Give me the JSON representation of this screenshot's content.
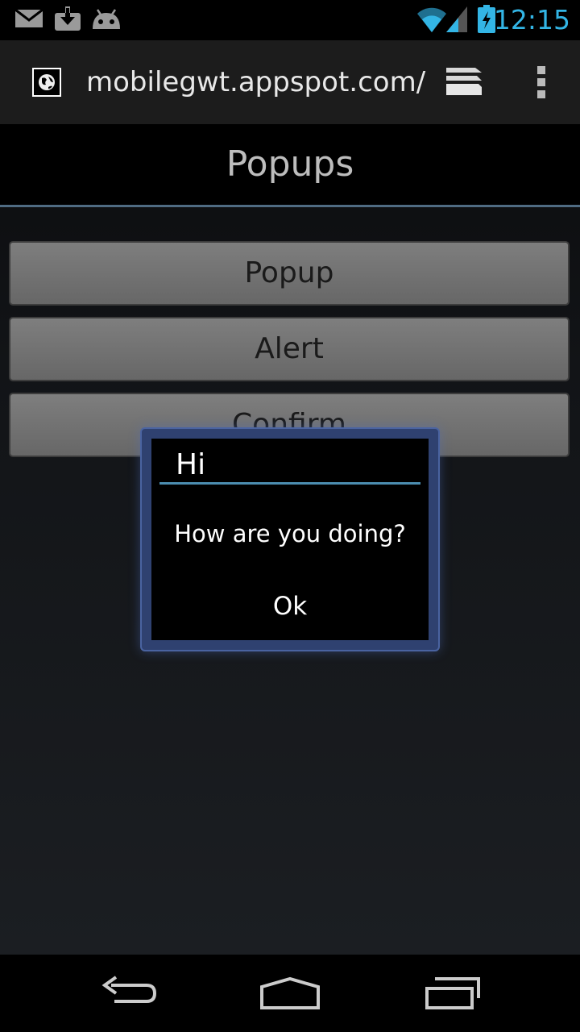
{
  "status_bar": {
    "time": "12:15",
    "icons": [
      "gmail-icon",
      "download-icon",
      "android-icon",
      "wifi-icon",
      "signal-icon",
      "battery-charging-icon"
    ],
    "accent_color": "#33b5e5"
  },
  "toolbar": {
    "url": "mobilegwt.appspot.com/",
    "favicon": "globe-icon",
    "tabs_icon": "tabs-icon",
    "menu_icon": "overflow-menu-icon"
  },
  "page": {
    "title": "Popups",
    "buttons": [
      {
        "label": "Popup"
      },
      {
        "label": "Alert"
      },
      {
        "label": "Confirm"
      }
    ]
  },
  "dialog": {
    "title": "Hi",
    "message": "How are you doing?",
    "ok_label": "Ok",
    "divider_color": "#4c8db0"
  },
  "nav_bar": {
    "icons": [
      "back-icon",
      "home-icon",
      "recent-apps-icon"
    ]
  }
}
